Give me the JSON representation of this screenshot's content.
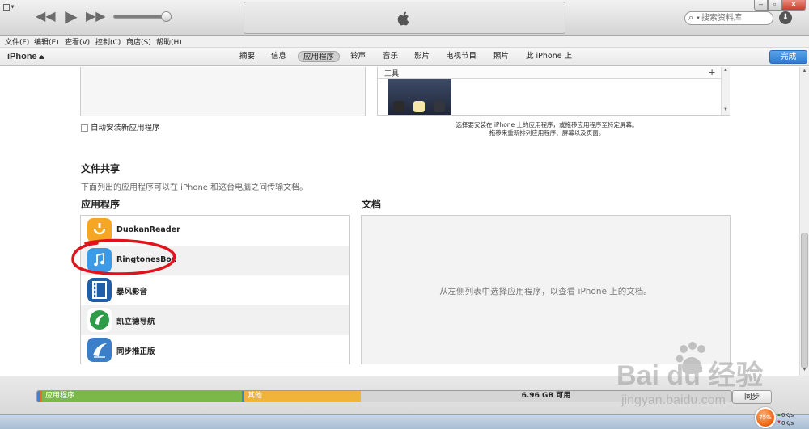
{
  "menu": {
    "items": [
      "文件(F)",
      "编辑(E)",
      "查看(V)",
      "控制(C)",
      "商店(S)",
      "帮助(H)"
    ]
  },
  "search": {
    "placeholder": "搜索资料库"
  },
  "device": {
    "name": "iPhone",
    "eject_icon": "eject-icon"
  },
  "tabs": [
    {
      "label": "摘要"
    },
    {
      "label": "信息"
    },
    {
      "label": "应用程序",
      "active": true
    },
    {
      "label": "铃声"
    },
    {
      "label": "音乐"
    },
    {
      "label": "影片"
    },
    {
      "label": "电视节目"
    },
    {
      "label": "照片"
    },
    {
      "label": "此 iPhone 上"
    }
  ],
  "done_label": "完成",
  "apps_section": {
    "auto_install_label": "自动安装新应用程序",
    "tools_label": "工具",
    "hint_line1": "选择要安装在 iPhone 上的应用程序，或拖移应用程序至特定屏幕。",
    "hint_line2": "拖移来重新排列应用程序、屏幕以及页面。"
  },
  "file_sharing": {
    "title": "文件共享",
    "description": "下面列出的应用程序可以在 iPhone 和这台电脑之间传输文档。",
    "apps_title": "应用程序",
    "docs_title": "文档",
    "docs_hint": "从左侧列表中选择应用程序，以查看 iPhone 上的文档。",
    "apps": [
      {
        "name": "DuokanReader",
        "icon": "duokan-reader-icon",
        "color": "#f5a623"
      },
      {
        "name": "RingtonesBox",
        "icon": "music-note-icon",
        "color": "#3b9be8"
      },
      {
        "name": "暴风影音",
        "icon": "film-strip-icon",
        "color": "#1f5ea8"
      },
      {
        "name": "凯立德导航",
        "icon": "careland-nav-icon",
        "color": "#2e9b4a"
      },
      {
        "name": "同步推正版",
        "icon": "tongbutui-icon",
        "color": "#3c7fc9"
      }
    ]
  },
  "capacity": {
    "segments": [
      {
        "label": "",
        "color": "#4a7fc8",
        "fraction": 0.004
      },
      {
        "label": "",
        "color": "#e36f2e",
        "fraction": 0.004
      },
      {
        "label": "应用程序",
        "color": "#7ab84a",
        "fraction": 0.288
      },
      {
        "label": "",
        "color": "#3f86c7",
        "fraction": 0.004
      },
      {
        "label": "其他",
        "color": "#f0b43a",
        "fraction": 0.168
      }
    ],
    "free_label": "6.96 GB 可用",
    "free_fraction": 0.532
  },
  "sync_label": "同步",
  "network": {
    "percent": "75%",
    "up": "0K/s",
    "down": "0K/s"
  },
  "watermark": {
    "logo": "Bai du 经验",
    "url": "jingyan.baidu.com"
  }
}
